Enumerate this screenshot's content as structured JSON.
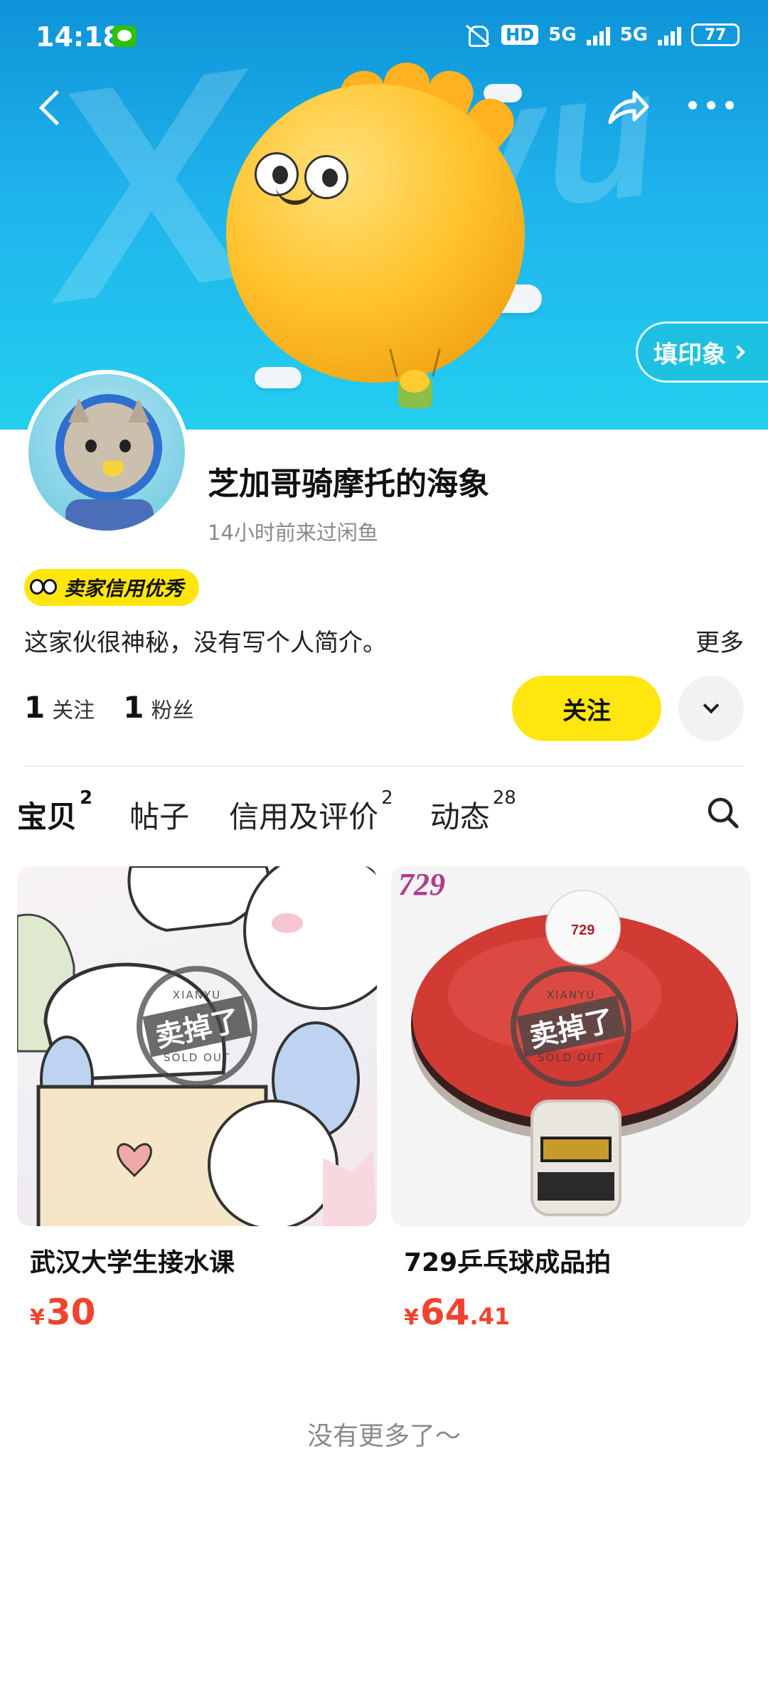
{
  "status_bar": {
    "time": "14:18",
    "hd": "HD",
    "network1": "5G",
    "network2": "5G",
    "battery": "77"
  },
  "banner": {
    "watermark_x": "X",
    "watermark_yu": "yu",
    "impression_button": "填印象"
  },
  "profile": {
    "username": "芝加哥骑摩托的海象",
    "last_seen": "14小时前来过闲鱼",
    "credit_badge": "卖家信用优秀",
    "bio": "这家伙很神秘，没有写个人简介。",
    "bio_more": "更多",
    "following_count": "1",
    "following_label": "关注",
    "followers_count": "1",
    "followers_label": "粉丝",
    "follow_button": "关注"
  },
  "tabs": [
    {
      "label": "宝贝",
      "count": "2"
    },
    {
      "label": "帖子",
      "count": ""
    },
    {
      "label": "信用及评价",
      "count": "2"
    },
    {
      "label": "动态",
      "count": "28"
    }
  ],
  "items": [
    {
      "title": "武汉大学生接水课",
      "currency": "¥",
      "price_int": "30",
      "price_dec": "",
      "stamp_top": "XIANYU",
      "stamp_main": "卖掉了",
      "stamp_bottom": "SOLD OUT"
    },
    {
      "title": "729乒乓球成品拍",
      "currency": "¥",
      "price_int": "64",
      "price_dec": ".41",
      "stamp_top": "XIANYU",
      "stamp_main": "卖掉了",
      "stamp_bottom": "SOLD OUT",
      "brand_text": "729"
    }
  ],
  "footer": {
    "no_more": "没有更多了～"
  },
  "colors": {
    "accent_yellow": "#ffe60f",
    "price_red": "#f0432f",
    "banner_blue": "#1fb3ec"
  }
}
